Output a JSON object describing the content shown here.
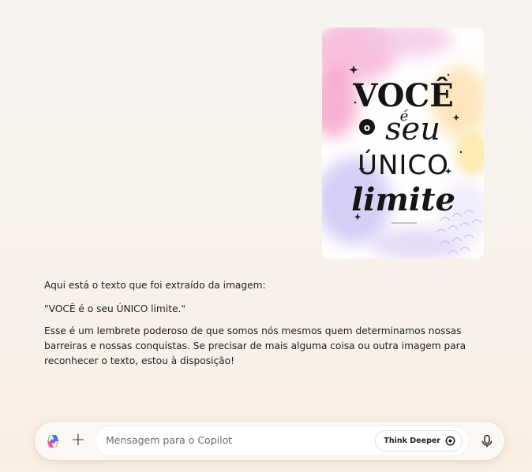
{
  "image": {
    "lines": [
      "VOCÊ",
      "é",
      "o",
      "seu",
      "ÚNICO",
      "limite"
    ]
  },
  "message": {
    "intro": "Aqui está o texto que foi extraído da imagem:",
    "quote": "\"VOCÊ é o seu ÚNICO limite.\"",
    "body": "Esse é um lembrete poderoso de que somos nós mesmos quem determinamos nossas barreiras e nossas conquistas. Se precisar de mais alguma coisa ou outra imagem para reconhecer o texto, estou à disposição!"
  },
  "composer": {
    "placeholder": "Mensagem para o Copilot",
    "think_deeper_label": "Think Deeper"
  },
  "icons": {
    "logo": "copilot-logo",
    "plus": "plus-icon",
    "think": "think-deeper-icon",
    "mic": "microphone-icon"
  },
  "colors": {
    "background": "#f7f3ef",
    "input": "#ffffff",
    "text": "#202020",
    "placeholder": "#6f6a66"
  }
}
